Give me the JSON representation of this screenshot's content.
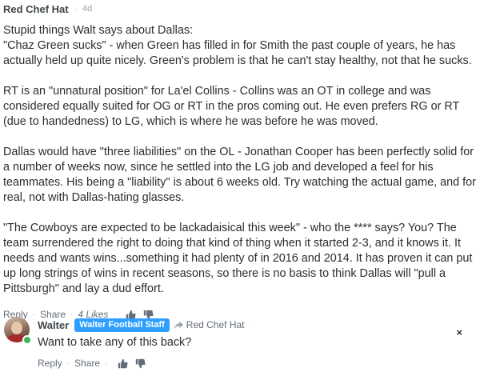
{
  "comment": {
    "author": "Red Chef Hat",
    "timestamp": "4d",
    "paragraphs": [
      "Stupid things Walt says about Dallas:\n\"Chaz Green sucks\" - when Green has filled in for Smith the past couple of years, he has actually held up quite nicely. Green's problem is that he can't stay healthy, not that he sucks.",
      "RT is an \"unnatural position\" for La'el Collins - Collins was an OT in college and was considered equally suited for OG or RT in the pros coming out. He even prefers RG or RT (due to handedness) to LG, which is where he was before he was moved.",
      "Dallas would have \"three liabilities\" on the OL - Jonathan Cooper has been perfectly solid for a number of weeks now, since he settled into the LG job and developed a feel for his teammates. His being a \"liability\" is about 6 weeks old. Try watching the actual game, and for real, not with Dallas-hating glasses.",
      "\"The Cowboys are expected to be lackadaisical this week\" - who the **** says? You? The team surrendered the right to doing that kind of thing when it started 2-3, and it knows it. It needs and wants wins...something it had plenty of in 2016 and 2014. It has proven it can put up long strings of wins in recent seasons, so there is no basis to think Dallas will \"pull a Pittsburgh\" and lay a dud effort."
    ],
    "actions": {
      "reply": "Reply",
      "share": "Share",
      "likes": "4 Likes",
      "separator": "·"
    }
  },
  "reply": {
    "author": "Walter",
    "badge": "Walter Football Staff",
    "reply_to": "Red Chef Hat",
    "body": "Want to take any of this back?",
    "close": "×",
    "actions": {
      "reply": "Reply",
      "share": "Share",
      "separator": "·"
    }
  },
  "icons": {
    "upvote": "thumbs-up-icon",
    "downvote": "thumbs-down-icon",
    "reply_arrow": "reply-arrow-icon",
    "close": "close-icon"
  },
  "colors": {
    "badge": "#2e9fff",
    "online": "#3bb75a",
    "text": "#2a2e2e",
    "muted": "#656c7a"
  }
}
